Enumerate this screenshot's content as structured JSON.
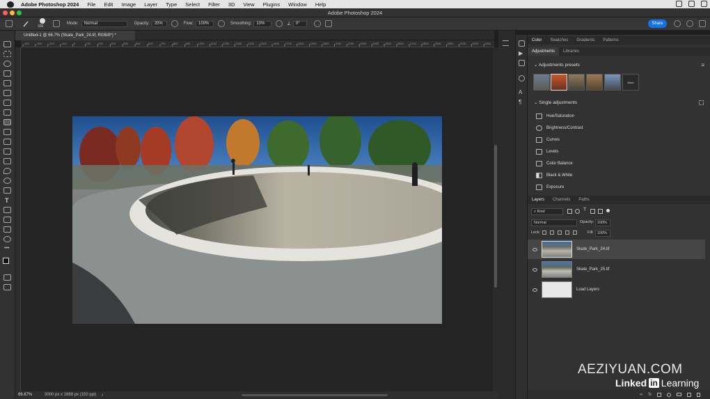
{
  "menubar": {
    "app": "Adobe Photoshop 2024",
    "items": [
      "File",
      "Edit",
      "Image",
      "Layer",
      "Type",
      "Select",
      "Filter",
      "3D",
      "View",
      "Plugins",
      "Window",
      "Help"
    ]
  },
  "window": {
    "title": "Adobe Photoshop 2024"
  },
  "options": {
    "brush_size": "300",
    "mode_label": "Mode:",
    "mode_value": "Normal",
    "opacity_label": "Opacity:",
    "opacity_value": "20%",
    "flow_label": "Flow:",
    "flow_value": "100%",
    "smoothing_label": "Smoothing:",
    "smoothing_value": "10%",
    "angle_value": "0°",
    "share_label": "Share"
  },
  "document": {
    "tab_title": "Untitled-1 @ 66.7% (Skate_Park_24.tif, RGB/8*) *",
    "zoom": "66.67%",
    "size": "3000 px x 1688 px (150 ppi)"
  },
  "ruler_ticks": [
    "-400",
    "-300",
    "-200",
    "-100",
    "0",
    "100",
    "200",
    "300",
    "400",
    "500",
    "600",
    "700",
    "800",
    "900",
    "1000",
    "1100",
    "1200",
    "1300",
    "1400",
    "1500",
    "1600",
    "1700",
    "1800",
    "1900",
    "2000",
    "2100",
    "2200",
    "2300",
    "2400",
    "2500",
    "2600",
    "2700",
    "2800",
    "2900",
    "3000",
    "3100",
    "3200",
    "3300"
  ],
  "panel": {
    "top_tabs": [
      "Color",
      "Swatches",
      "Gradients",
      "Patterns"
    ],
    "adj_tabs": [
      "Adjustments",
      "Libraries"
    ],
    "presets_title": "Adjustments presets",
    "more_label": "More",
    "single_title": "Single adjustments",
    "adjustments": [
      "Hue/Saturation",
      "Brightness/Contrast",
      "Curves",
      "Levels",
      "Color Balance",
      "Black & White",
      "Exposure"
    ],
    "layer_tabs": [
      "Layers",
      "Channels",
      "Paths"
    ],
    "kind_label": "Kind",
    "blend_mode": "Normal",
    "opacity_label": "Opacity:",
    "opacity_value": "100%",
    "lock_label": "Lock:",
    "fill_label": "Fill:",
    "fill_value": "100%",
    "layers": [
      {
        "name": "Skate_Park_24.tif",
        "selected": true
      },
      {
        "name": "Skate_Park_25.tif",
        "selected": false
      },
      {
        "name": "Load Layers",
        "selected": false
      }
    ]
  },
  "watermark": {
    "text": "AEZIYUAN.COM",
    "brand": "Linked",
    "brand_in": "in",
    "brand_tail": "Learning"
  },
  "colors": {
    "accent": "#1473e6",
    "panel_bg": "#323232",
    "canvas_bg": "#242424"
  }
}
